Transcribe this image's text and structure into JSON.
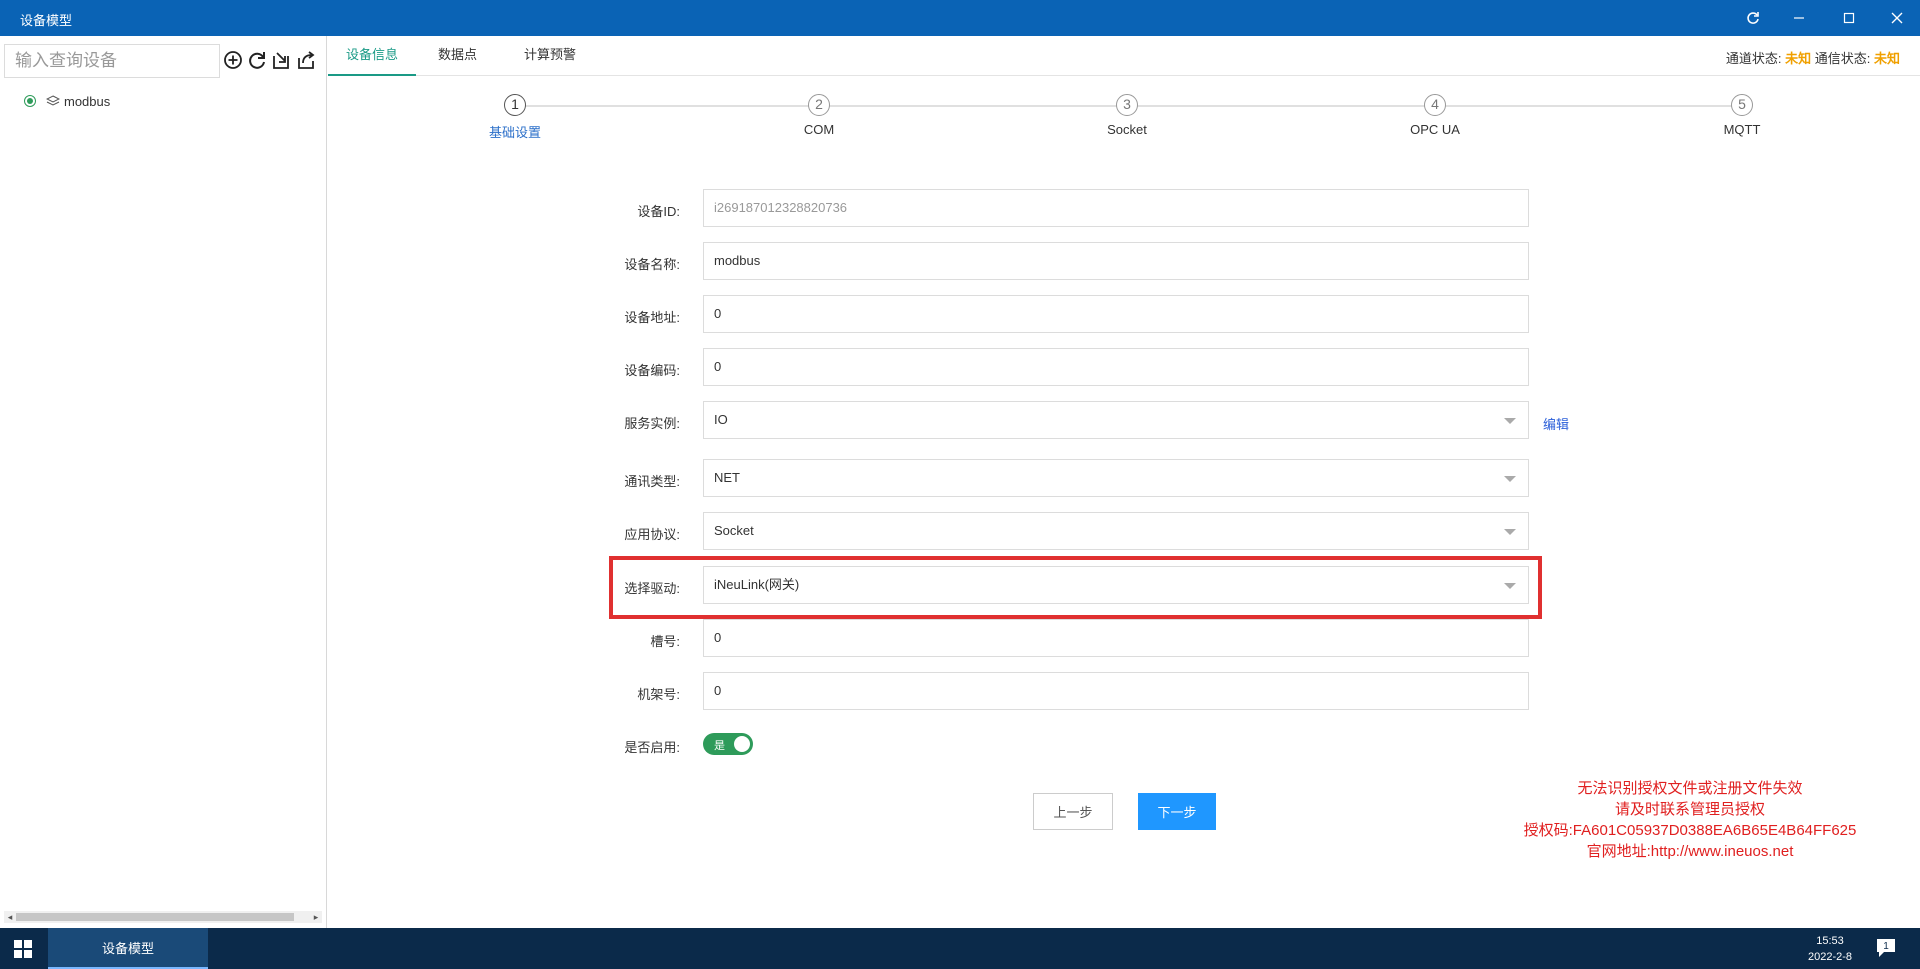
{
  "window": {
    "title": "设备模型"
  },
  "sidebar": {
    "search_placeholder": "输入查询设备",
    "tree": [
      {
        "label": "modbus",
        "selected": true
      }
    ]
  },
  "tabs": [
    {
      "label": "设备信息",
      "active": true
    },
    {
      "label": "数据点",
      "active": false
    },
    {
      "label": "计算预警",
      "active": false
    }
  ],
  "status": {
    "channel_label": "通道状态:",
    "channel_value": "未知",
    "comm_label": "通信状态:",
    "comm_value": "未知"
  },
  "steps": [
    {
      "num": "1",
      "label": "基础设置",
      "active": true
    },
    {
      "num": "2",
      "label": "COM",
      "active": false
    },
    {
      "num": "3",
      "label": "Socket",
      "active": false
    },
    {
      "num": "4",
      "label": "OPC UA",
      "active": false
    },
    {
      "num": "5",
      "label": "MQTT",
      "active": false
    }
  ],
  "form": {
    "device_id": {
      "label": "设备ID:",
      "value": "i269187012328820736"
    },
    "device_name": {
      "label": "设备名称:",
      "value": "modbus"
    },
    "device_addr": {
      "label": "设备地址:",
      "value": "0"
    },
    "device_code": {
      "label": "设备编码:",
      "value": "0"
    },
    "service_instance": {
      "label": "服务实例:",
      "value": "IO",
      "edit": "编辑"
    },
    "comm_type": {
      "label": "通讯类型:",
      "value": "NET"
    },
    "protocol": {
      "label": "应用协议:",
      "value": "Socket"
    },
    "driver": {
      "label": "选择驱动:",
      "value": "iNeuLink(网关)"
    },
    "slot": {
      "label": "槽号:",
      "value": "0"
    },
    "rack": {
      "label": "机架号:",
      "value": "0"
    },
    "enabled": {
      "label": "是否启用:",
      "value": "是"
    }
  },
  "buttons": {
    "prev": "上一步",
    "next": "下一步"
  },
  "license": {
    "line1": "无法识别授权文件或注册文件失效",
    "line2": "请及时联系管理员授权",
    "line3": "授权码:FA601C05937D0388EA6B65E4B64FF625",
    "line4": "官网地址:http://www.ineuos.net"
  },
  "taskbar": {
    "app": "设备模型",
    "time": "15:53",
    "date": "2022-2-8",
    "notifications": "1"
  },
  "colors": {
    "titlebar": "#0a63b5",
    "accent": "#1a9a86",
    "warning": "#f0a000",
    "highlight": "#e03030",
    "primary_button": "#1f97ff",
    "license_text": "#e02020"
  }
}
